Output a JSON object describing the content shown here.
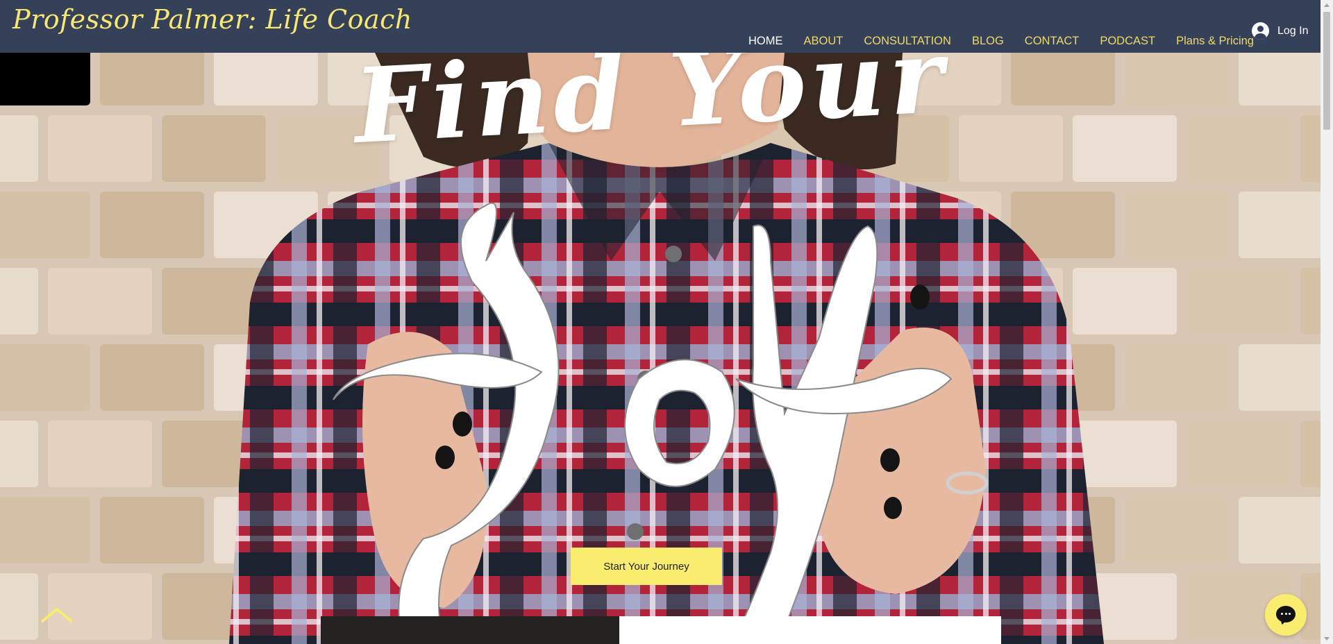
{
  "site": {
    "title": "Professor Palmer: Life Coach"
  },
  "nav": {
    "items": [
      {
        "label": "HOME",
        "active": true
      },
      {
        "label": "ABOUT"
      },
      {
        "label": "CONSULTATION"
      },
      {
        "label": "BLOG"
      },
      {
        "label": "CONTACT"
      },
      {
        "label": "PODCAST"
      },
      {
        "label": "Plans & Pricing"
      }
    ]
  },
  "login": {
    "label": "Log In",
    "icon": "user-avatar-icon"
  },
  "hero": {
    "headline_line1": "Find Your",
    "headline_line2": "Joy",
    "cta_label": "Start Your Journey"
  },
  "widgets": {
    "scroll_up_icon": "chevron-up-icon",
    "chat_icon": "chat-bubble-icon"
  },
  "colors": {
    "header_bg": "#354059",
    "accent_yellow": "#f9ec6f",
    "nav_text": "#f1d967",
    "nav_active": "#ffffff"
  }
}
